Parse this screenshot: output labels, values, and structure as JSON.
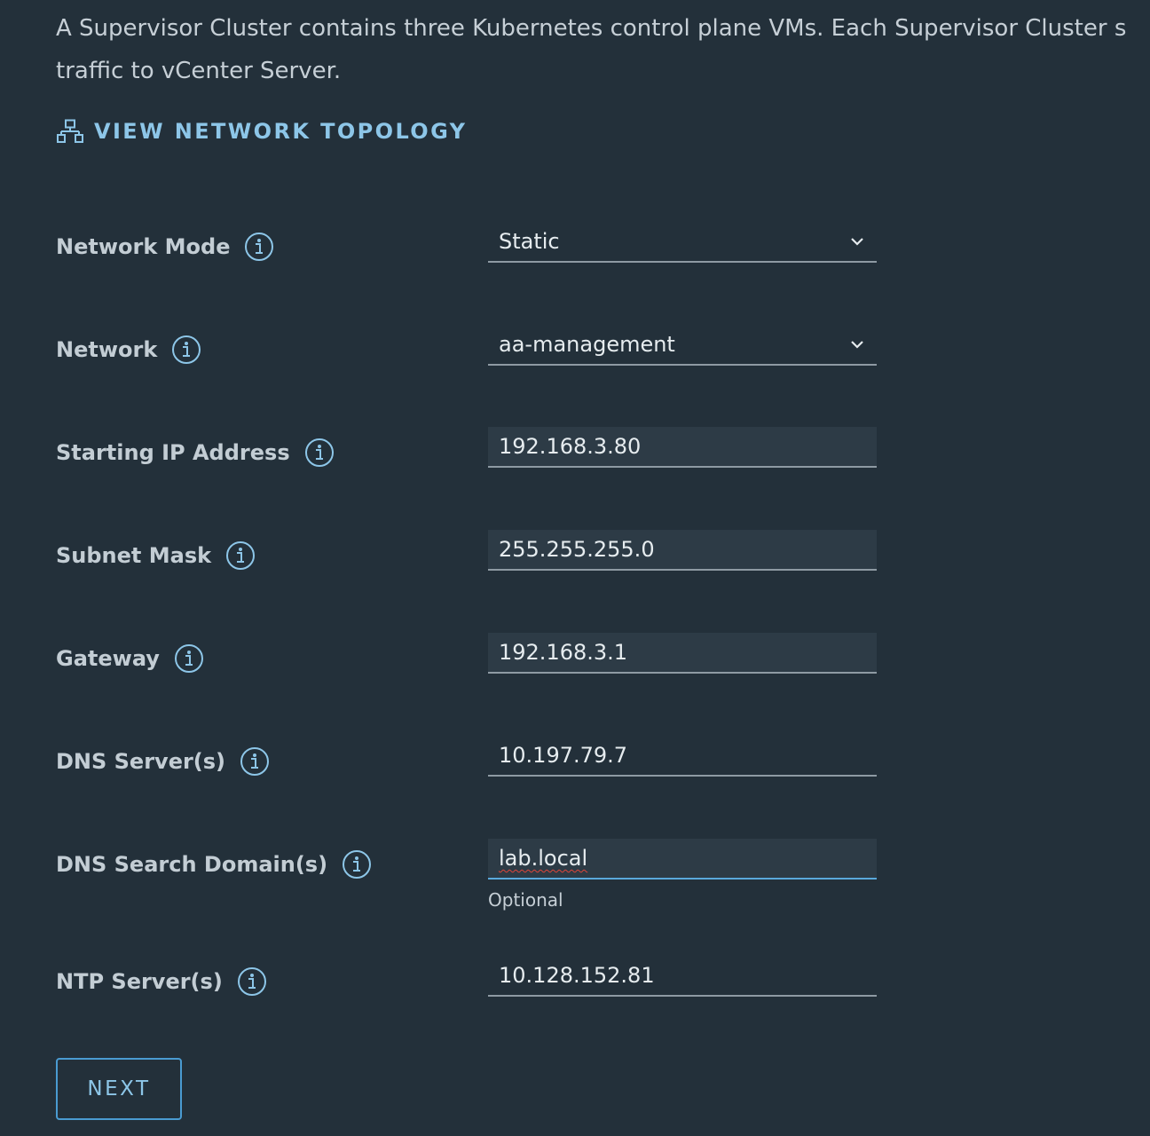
{
  "description": "A Supervisor Cluster contains three Kubernetes control plane VMs. Each Supervisor Cluster s\ntraffic to vCenter Server.",
  "topology_link": {
    "label": "VIEW NETWORK TOPOLOGY",
    "icon": "network-topology-icon"
  },
  "fields": {
    "network_mode": {
      "label": "Network Mode",
      "value": "Static",
      "type": "select"
    },
    "network": {
      "label": "Network",
      "value": "aa-management",
      "type": "select"
    },
    "starting_ip": {
      "label": "Starting IP Address",
      "value": "192.168.3.80",
      "type": "input"
    },
    "subnet_mask": {
      "label": "Subnet Mask",
      "value": "255.255.255.0",
      "type": "input"
    },
    "gateway": {
      "label": "Gateway",
      "value": "192.168.3.1",
      "type": "input"
    },
    "dns_servers": {
      "label": "DNS Server(s)",
      "value": "10.197.79.7",
      "type": "input"
    },
    "dns_search_domains": {
      "label": "DNS Search Domain(s)",
      "value": "lab.local",
      "helper": "Optional",
      "type": "input"
    },
    "ntp_servers": {
      "label": "NTP Server(s)",
      "value": "10.128.152.81",
      "type": "input"
    }
  },
  "next_button": {
    "label": "NEXT"
  },
  "colors": {
    "background": "#23303a",
    "accent": "#4a9bd1",
    "link": "#8dc6e8",
    "input_fill": "#2d3b46"
  }
}
